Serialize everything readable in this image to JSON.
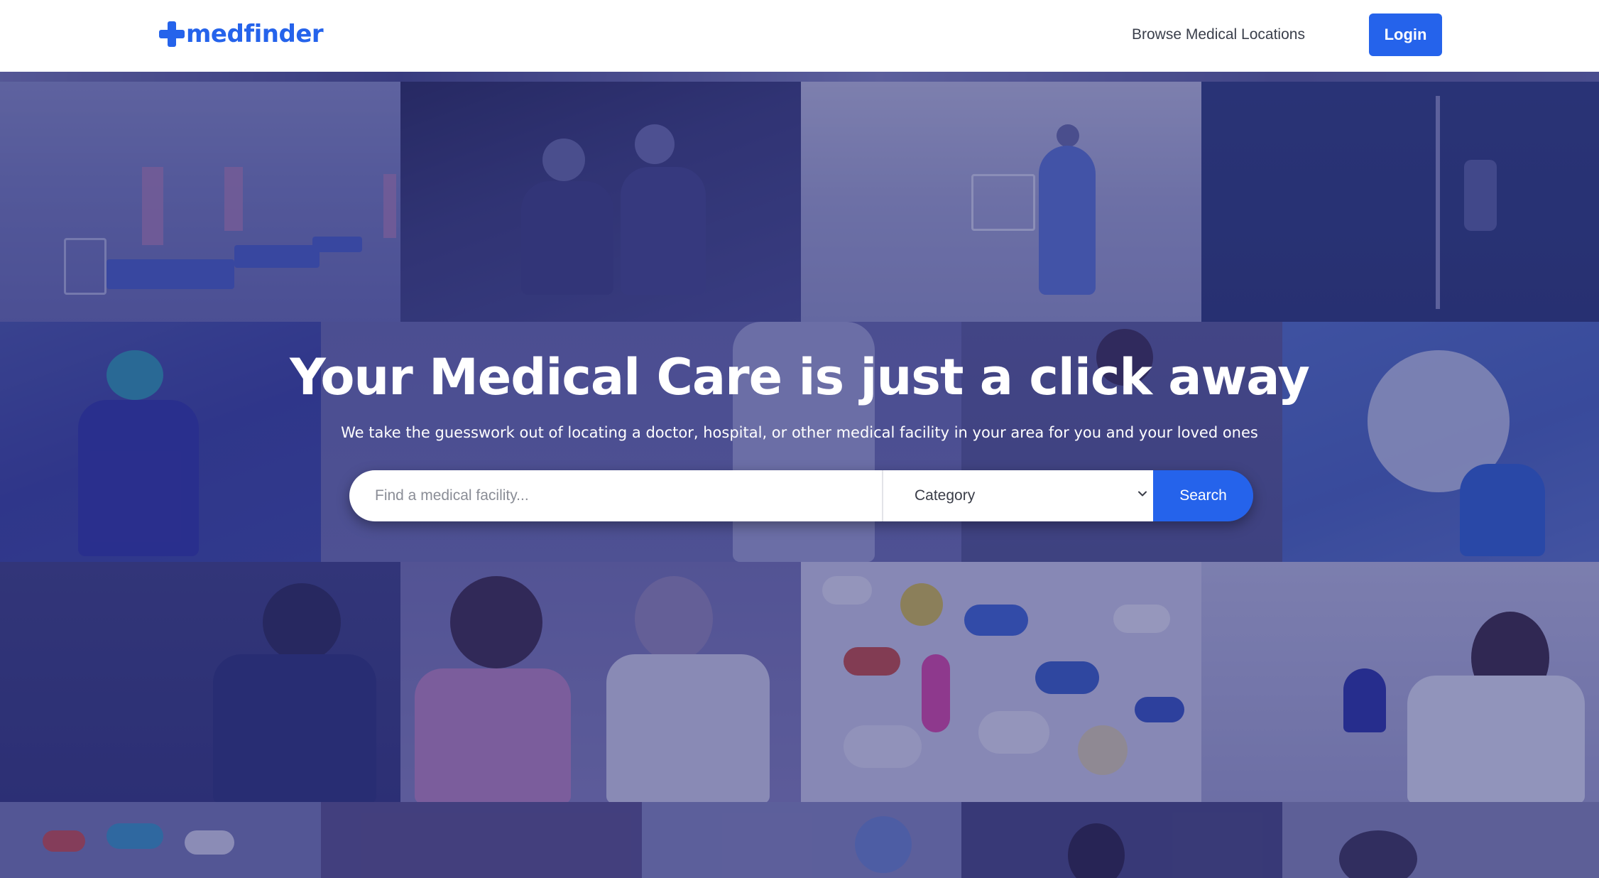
{
  "header": {
    "logo_text": "medfinder",
    "nav_browse": "Browse Medical Locations",
    "login_label": "Login"
  },
  "hero": {
    "headline": "Your Medical Care is just a click away",
    "subline": "We take the guesswork out of locating a doctor, hospital, or other medical facility in your area for you and your loved ones"
  },
  "search": {
    "placeholder": "Find a medical facility...",
    "category_selected": "Category",
    "button_label": "Search"
  },
  "colors": {
    "brand_blue": "#2563eb",
    "hero_overlay": "#24266e"
  },
  "icons": {
    "logo": "medical-cross-icon",
    "category_toggle": "chevron-down-icon"
  }
}
